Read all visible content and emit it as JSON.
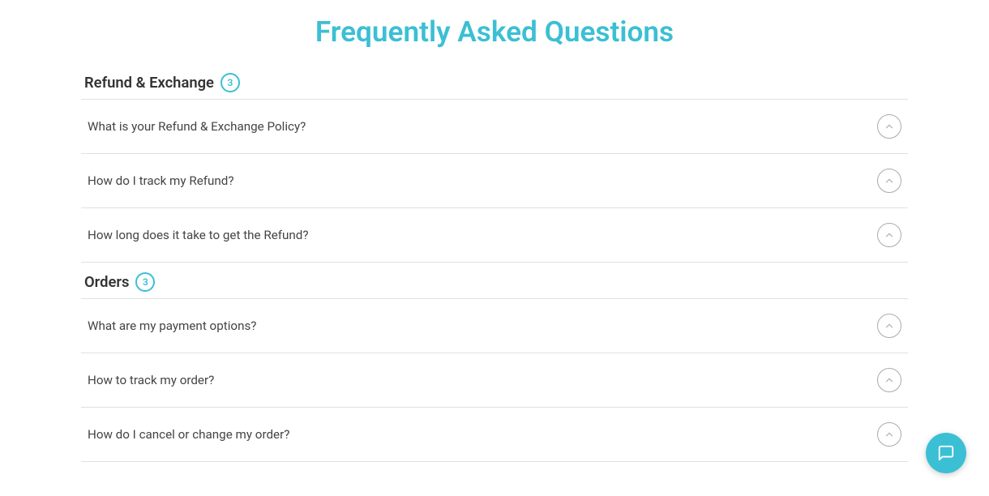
{
  "page": {
    "title": "Frequently Asked Questions"
  },
  "sections": [
    {
      "id": "refund-exchange",
      "title": "Refund & Exchange",
      "badge": "3",
      "items": [
        {
          "id": "q1",
          "question": "What is your Refund & Exchange Policy?"
        },
        {
          "id": "q2",
          "question": "How do I track my Refund?"
        },
        {
          "id": "q3",
          "question": "How long does it take to get the Refund?"
        }
      ]
    },
    {
      "id": "orders",
      "title": "Orders",
      "badge": "3",
      "items": [
        {
          "id": "q4",
          "question": "What are my payment options?"
        },
        {
          "id": "q5",
          "question": "How to track my order?"
        },
        {
          "id": "q6",
          "question": "How do I cancel or change my order?"
        }
      ]
    }
  ],
  "chat": {
    "label": "Chat"
  }
}
